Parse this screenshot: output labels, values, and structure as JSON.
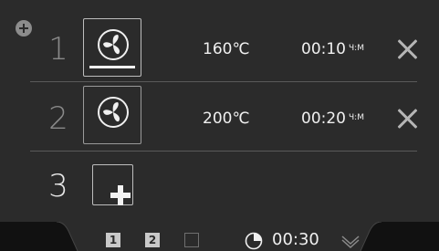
{
  "steps": [
    {
      "number": "1",
      "icon": "fan-icon",
      "temperature": "160℃",
      "time": "00:10",
      "time_unit": "Ч:М"
    },
    {
      "number": "2",
      "icon": "fan-icon",
      "temperature": "200℃",
      "time": "00:20",
      "time_unit": "Ч:М"
    }
  ],
  "new_step": {
    "number": "3",
    "icon": "plus-icon"
  },
  "bottom_bar": {
    "slots": [
      "1",
      "2"
    ],
    "total_time": "00:30"
  },
  "colors": {
    "background": "#2b2b2b",
    "text": "#f0f0f0",
    "muted": "#8a8a8a"
  }
}
